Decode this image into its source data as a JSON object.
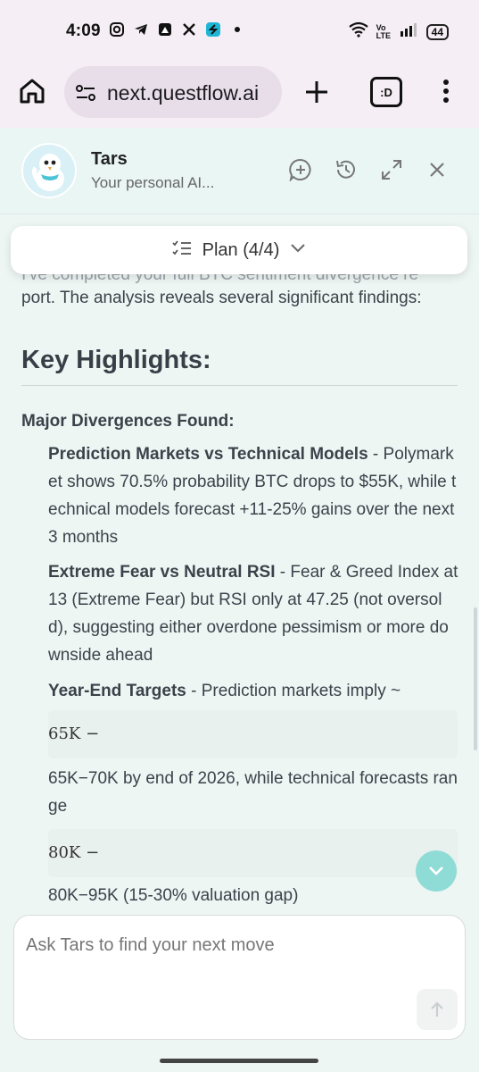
{
  "status": {
    "time": "4:09",
    "icons": [
      "instagram-icon",
      "telegram-icon",
      "app-icon",
      "x-icon",
      "stackshift-icon",
      "dot-icon"
    ],
    "battery": "44",
    "network_label": "Vo LTE"
  },
  "browser": {
    "url": "next.questflow.ai",
    "tabs_label": ":D"
  },
  "chat": {
    "agent_name": "Tars",
    "agent_subtitle": "Your personal AI...",
    "plan_label": "Plan (4/4)",
    "intro_partial": "I've completed your full BTC sentiment divergence re",
    "intro_line2": "port. The analysis reveals several significant findings:",
    "heading": "Key Highlights:",
    "subheading": "Major Divergences Found:",
    "items": [
      {
        "title": "Prediction Markets vs Technical Models",
        "body": " - Polymarket shows 70.5% probability BTC drops to $55K, while technical models forecast +11-25% gains over the next 3 months"
      },
      {
        "title": "Extreme Fear vs Neutral RSI",
        "body": " - Fear & Greed Index at 13 (Extreme Fear) but RSI only at 47.25 (not oversold), suggesting either overdone pessimism or more downside ahead"
      },
      {
        "title": "Year-End Targets",
        "body": " - Prediction markets imply ~"
      }
    ],
    "math1": "65K −",
    "line_after_math1": "65K−70K by end of 2026, while technical forecasts range",
    "math2": "80K −",
    "line_after_math2": "80K−95K (15-30% valuation gap)",
    "input_placeholder": "Ask Tars to find your next move"
  }
}
